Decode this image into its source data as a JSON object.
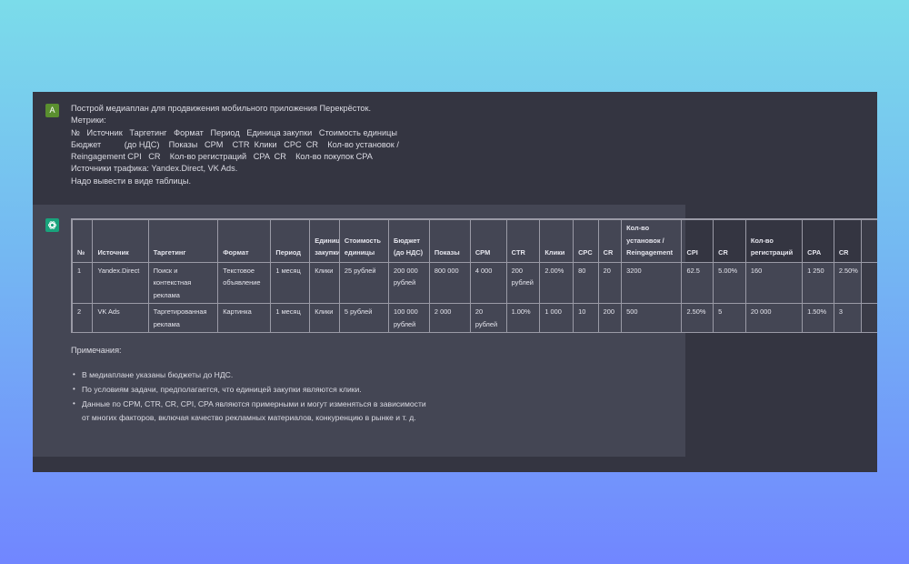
{
  "user_message": {
    "avatar_letter": "A",
    "lines": [
      "Построй медиаплан для продвижения мобильного приложения Перекрёсток.",
      "Метрики:",
      "№   Источник   Таргетинг   Формат   Период   Единица закупки   Стоимость единицы",
      "Бюджет          (до НДС)    Показы   CPM    CTR  Клики   CPC  CR    Кол-во установок /",
      "Reingagement CPI   CR    Кол-во регистраций   CPA  CR    Кол-во покупок CPA",
      "Источники трафика: Yandex.Direct, VK Ads.",
      "Надо вывести в виде таблицы."
    ]
  },
  "assistant_message": {
    "table": {
      "headers": [
        "№",
        "Источник",
        "Таргетинг",
        "Формат",
        "Период",
        "Единица закупки",
        "Стоимость единицы",
        "Бюджет (до НДС)",
        "Показы",
        "CPM",
        "CTR",
        "Клики",
        "CPC",
        "CR",
        "Кол-во установок / Reingagement",
        "CPI",
        "CR",
        "Кол-во регистраций",
        "CPA",
        "CR",
        ""
      ],
      "rows": [
        [
          "1",
          "Yandex.Direct",
          "Поиск и контекстная реклама",
          "Текстовое объявление",
          "1 месяц",
          "Клики",
          "25 рублей",
          "200 000 рублей",
          "800 000",
          "4 000",
          "200 рублей",
          "2.00%",
          "80",
          "20",
          "3200",
          "62.5",
          "5.00%",
          "160",
          "1 250",
          "2.50%",
          ""
        ],
        [
          "2",
          "VK Ads",
          "Таргетированная реклама",
          "Картинка",
          "1 месяц",
          "Клики",
          "5 рублей",
          "100 000 рублей",
          "2 000",
          "20 рублей",
          "1.00%",
          "1 000",
          "10",
          "200",
          "500",
          "2.50%",
          "5",
          "20 000",
          "1.50%",
          "3",
          ""
        ]
      ]
    },
    "notes_heading": "Примечания:",
    "notes": [
      "В медиаплане указаны бюджеты до НДС.",
      "По условиям задачи, предполагается, что единицей закупки являются клики.",
      "Данные по CPM, CTR, CR, CPI, CPA являются примерными и могут изменяться в зависимости от многих факторов, включая качество рекламных материалов, конкуренцию в рынке и т. д."
    ]
  },
  "colors": {
    "background_top": "#7bdcea",
    "background_bottom": "#7186ff",
    "user_panel": "#343541",
    "assistant_panel": "#444654",
    "user_avatar": "#5a8f2f",
    "assistant_avatar": "#19a37c"
  },
  "icons": {
    "assistant_avatar": "openai-logo-icon"
  }
}
